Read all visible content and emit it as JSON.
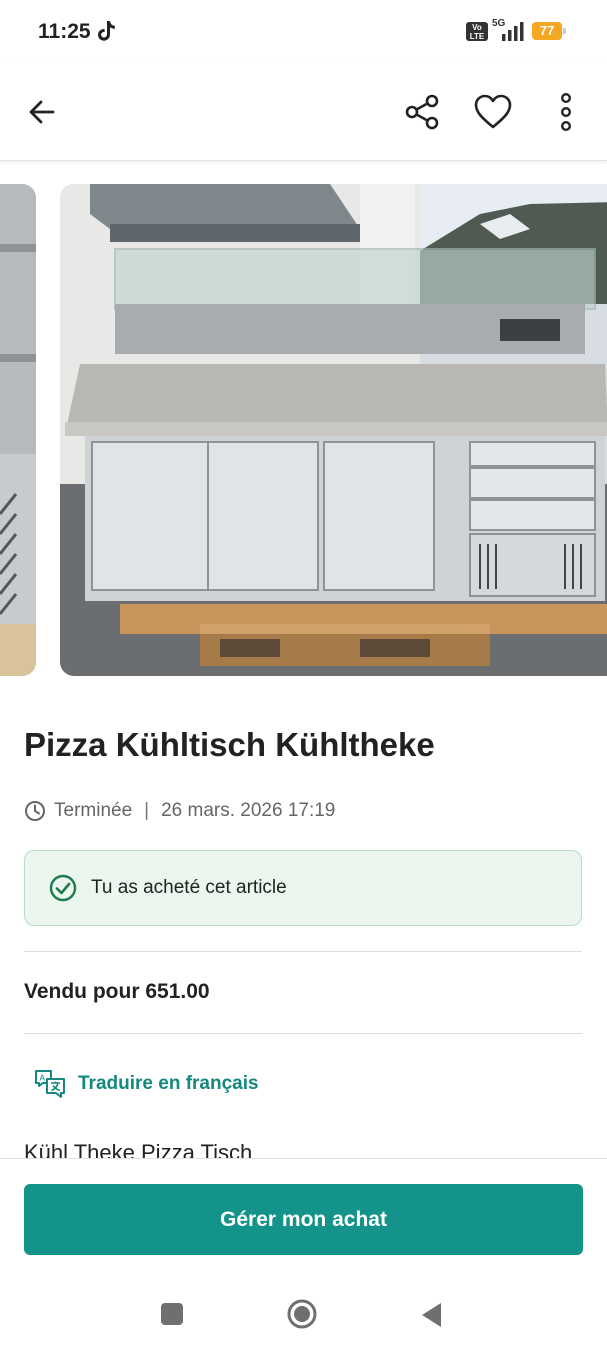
{
  "status_bar": {
    "time": "11:25",
    "volte": "Vo LTE",
    "network": "5G",
    "battery": "77",
    "icons": [
      "tiktok-icon",
      "signal-icon"
    ]
  },
  "app_bar": {
    "icons": [
      "back-arrow-icon",
      "share-icon",
      "heart-icon",
      "more-vert-icon"
    ]
  },
  "listing": {
    "title": "Pizza Kühltisch Kühltheke",
    "status": "Terminée",
    "separator": "|",
    "date": "26 mars. 2026 17:19",
    "purchase_notice": "Tu as acheté cet article",
    "sold_for": "Vendu pour 651.00",
    "translate_label": "Traduire en français",
    "description_preview": "Kühl Theke Pizza Tisch"
  },
  "actions": {
    "manage_purchase": "Gérer mon achat"
  },
  "colors": {
    "accent": "#13938a",
    "accent_text": "#14897f",
    "notice_bg": "#eaf6ee",
    "notice_border": "#b9dcc6",
    "check_green": "#1d7a4a",
    "battery": "#f5a623"
  }
}
